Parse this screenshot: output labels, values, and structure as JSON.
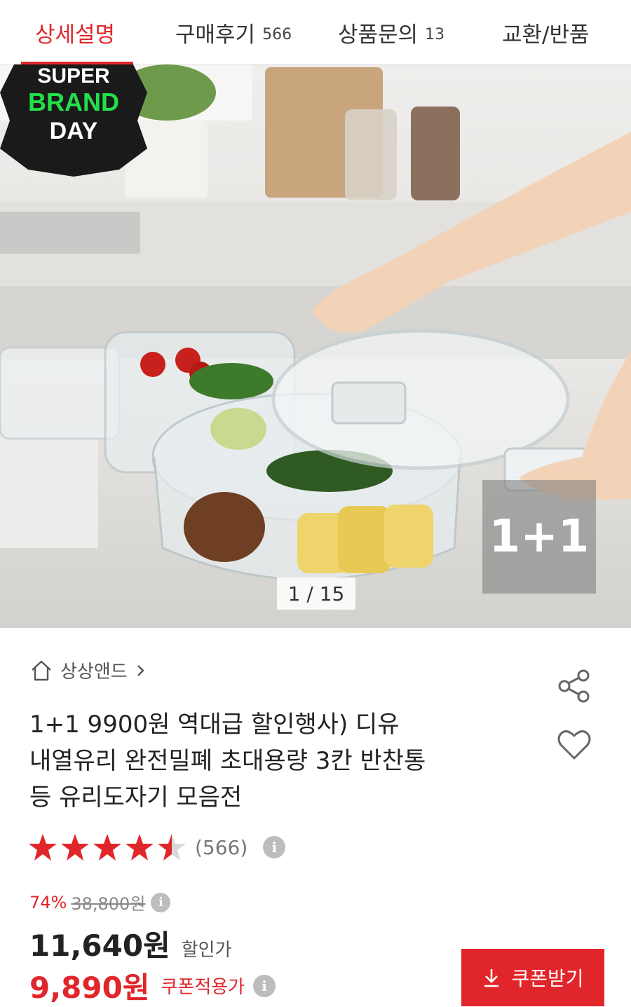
{
  "tabs": [
    {
      "label": "상세설명",
      "count": ""
    },
    {
      "label": "구매후기",
      "count": "566"
    },
    {
      "label": "상품문의",
      "count": "13"
    },
    {
      "label": "교환/반품",
      "count": ""
    }
  ],
  "hero": {
    "badge": {
      "line1": "SUPER",
      "line2": "BRAND",
      "line3": "DAY"
    },
    "overlay_label": "1+1",
    "pager": "1 / 15"
  },
  "product": {
    "brand": "상상앤드",
    "title_lines": [
      "1+1 9900원 역대급 할인행사) 디유",
      "내열유리 완전밀폐 초대용량 3칸 반찬통",
      "등 유리도자기 모음전"
    ],
    "rating": 4.5,
    "review_count": "(566)",
    "info_glyph": "i",
    "discount_rate": "74%",
    "original_price": "38,800원",
    "sale_price": "11,640원",
    "sale_label": "할인가",
    "coupon_price": "9,890원",
    "coupon_label": "쿠폰적용가",
    "coupon_button": "쿠폰받기"
  },
  "colors": {
    "accent": "#e1262b",
    "badge_green": "#22e04a",
    "badge_black": "#1a1a1a"
  }
}
